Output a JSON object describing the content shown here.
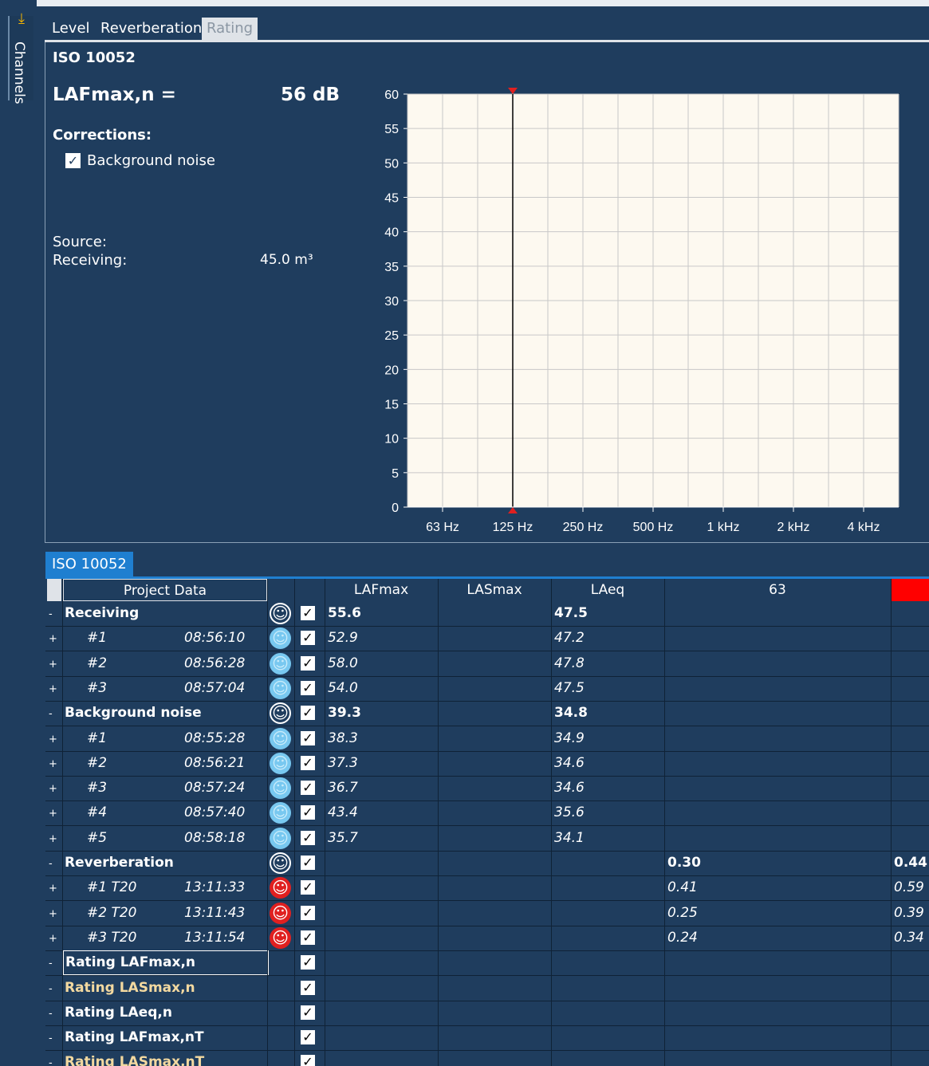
{
  "sidebar": {
    "channels_label": "Channels",
    "icon": "download-arrow-icon"
  },
  "tabs": [
    {
      "label": "Level"
    },
    {
      "label": "Reverberation"
    },
    {
      "label": "Rating",
      "active": true
    }
  ],
  "summary": {
    "standard": "ISO 10052",
    "metric_label": "LAFmax,n =",
    "metric_value": "56 dB",
    "corrections_label": "Corrections:",
    "background_noise_label": "Background noise",
    "background_noise_checked": true,
    "source_label": "Source:",
    "receiving_label": "Receiving:",
    "receiving_volume": "45.0 m³"
  },
  "chart_data": {
    "type": "line",
    "x_categories": [
      "63 Hz",
      "125 Hz",
      "250 Hz",
      "500 Hz",
      "1 kHz",
      "2 kHz",
      "4 kHz"
    ],
    "y_ticks": [
      "60",
      "55",
      "50",
      "45",
      "40",
      "35",
      "30",
      "25",
      "20",
      "15",
      "10",
      "5",
      "0"
    ],
    "ylim": [
      0,
      60
    ],
    "grid": true,
    "marker_category": "125 Hz",
    "series": []
  },
  "table": {
    "tab_label": "ISO 10052",
    "headers": [
      "Project Data",
      "LAFmax",
      "LASmax",
      "LAeq",
      "63"
    ],
    "header_marker_color": "#ff0000",
    "rows": [
      {
        "type": "group",
        "name": "Receiving",
        "time": "",
        "smiley": "white",
        "lafmax": "55.6",
        "lasmax": "",
        "laeq": "47.5",
        "c63": "",
        "c125": ""
      },
      {
        "type": "item",
        "name": "#1",
        "time": "08:56:10",
        "smiley": "blue",
        "lafmax": "52.9",
        "lasmax": "",
        "laeq": "47.2",
        "c63": "",
        "c125": ""
      },
      {
        "type": "item",
        "name": "#2",
        "time": "08:56:28",
        "smiley": "blue",
        "lafmax": "58.0",
        "lasmax": "",
        "laeq": "47.8",
        "c63": "",
        "c125": ""
      },
      {
        "type": "item",
        "name": "#3",
        "time": "08:57:04",
        "smiley": "blue",
        "lafmax": "54.0",
        "lasmax": "",
        "laeq": "47.5",
        "c63": "",
        "c125": ""
      },
      {
        "type": "group",
        "name": "Background noise",
        "time": "",
        "smiley": "white",
        "lafmax": "39.3",
        "lasmax": "",
        "laeq": "34.8",
        "c63": "",
        "c125": ""
      },
      {
        "type": "item",
        "name": "#1",
        "time": "08:55:28",
        "smiley": "blue",
        "lafmax": "38.3",
        "lasmax": "",
        "laeq": "34.9",
        "c63": "",
        "c125": ""
      },
      {
        "type": "item",
        "name": "#2",
        "time": "08:56:21",
        "smiley": "blue",
        "lafmax": "37.3",
        "lasmax": "",
        "laeq": "34.6",
        "c63": "",
        "c125": ""
      },
      {
        "type": "item",
        "name": "#3",
        "time": "08:57:24",
        "smiley": "blue",
        "lafmax": "36.7",
        "lasmax": "",
        "laeq": "34.6",
        "c63": "",
        "c125": ""
      },
      {
        "type": "item",
        "name": "#4",
        "time": "08:57:40",
        "smiley": "blue",
        "lafmax": "43.4",
        "lasmax": "",
        "laeq": "35.6",
        "c63": "",
        "c125": ""
      },
      {
        "type": "item",
        "name": "#5",
        "time": "08:58:18",
        "smiley": "blue",
        "lafmax": "35.7",
        "lasmax": "",
        "laeq": "34.1",
        "c63": "",
        "c125": ""
      },
      {
        "type": "group",
        "name": "Reverberation",
        "time": "",
        "smiley": "white",
        "lafmax": "",
        "lasmax": "",
        "laeq": "",
        "c63": "0.30",
        "c125": "0.44"
      },
      {
        "type": "item",
        "name": "#1 T20",
        "time": "13:11:33",
        "smiley": "red",
        "lafmax": "",
        "lasmax": "",
        "laeq": "",
        "c63": "0.41",
        "c125": "0.59"
      },
      {
        "type": "item",
        "name": "#2 T20",
        "time": "13:11:43",
        "smiley": "red",
        "lafmax": "",
        "lasmax": "",
        "laeq": "",
        "c63": "0.25",
        "c125": "0.39"
      },
      {
        "type": "item",
        "name": "#3 T20",
        "time": "13:11:54",
        "smiley": "red",
        "lafmax": "",
        "lasmax": "",
        "laeq": "",
        "c63": "0.24",
        "c125": "0.34"
      },
      {
        "type": "rating",
        "name": "Rating LAFmax,n",
        "time": "",
        "smiley": "",
        "lafmax": "",
        "lasmax": "",
        "laeq": "",
        "c63": "",
        "c125": "",
        "selected": true
      },
      {
        "type": "rating",
        "name": "Rating LASmax,n",
        "time": "",
        "smiley": "",
        "lafmax": "",
        "lasmax": "",
        "laeq": "",
        "c63": "",
        "c125": "",
        "highlight": true
      },
      {
        "type": "rating",
        "name": "Rating LAeq,n",
        "time": "",
        "smiley": "",
        "lafmax": "",
        "lasmax": "",
        "laeq": "",
        "c63": "",
        "c125": ""
      },
      {
        "type": "rating",
        "name": "Rating LAFmax,nT",
        "time": "",
        "smiley": "",
        "lafmax": "",
        "lasmax": "",
        "laeq": "",
        "c63": "",
        "c125": ""
      },
      {
        "type": "rating",
        "name": "Rating LASmax,nT",
        "time": "",
        "smiley": "",
        "lafmax": "",
        "lasmax": "",
        "laeq": "",
        "c63": "",
        "c125": "",
        "highlight": true
      }
    ]
  }
}
